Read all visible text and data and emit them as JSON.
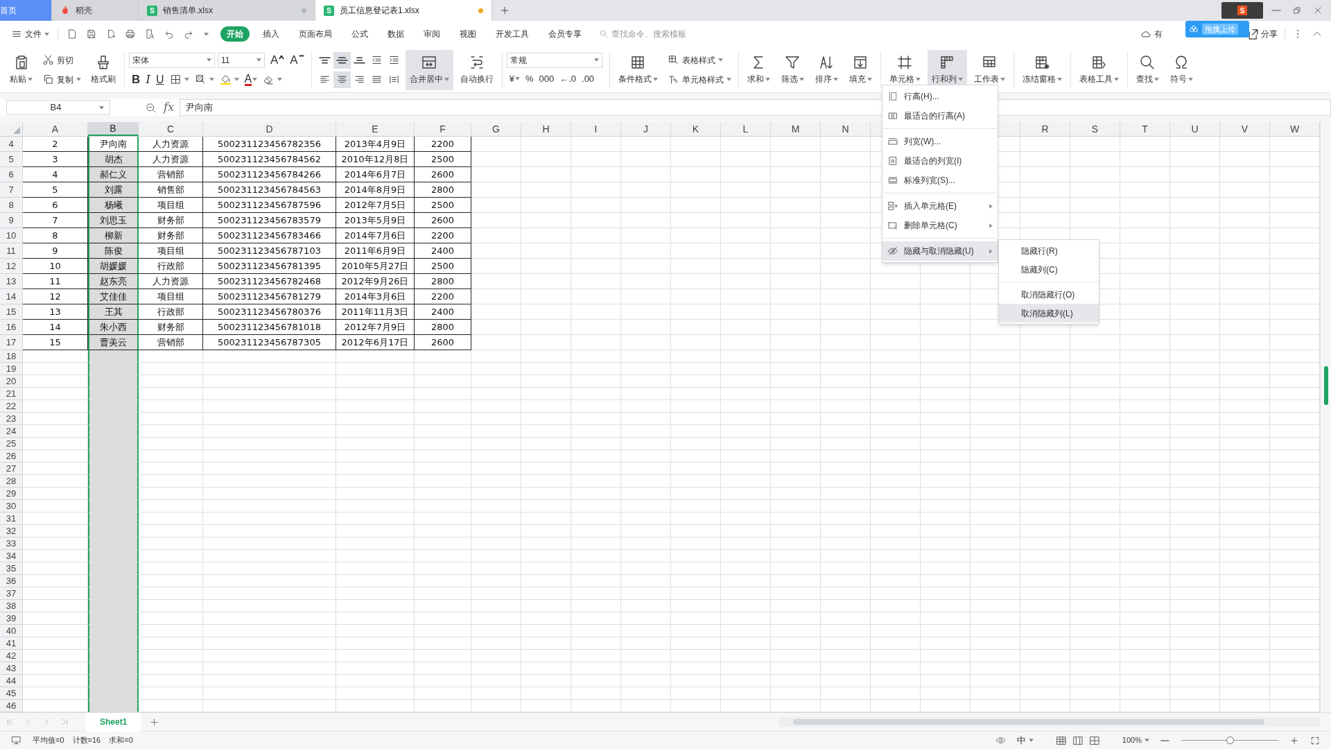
{
  "doc_tabs": [
    {
      "label": "首页",
      "kind": "home",
      "selected": false
    },
    {
      "label": "稻壳",
      "kind": "docer",
      "selected": false
    },
    {
      "label": "销售清单.xlsx",
      "kind": "sheet",
      "badge": "S",
      "modified": false,
      "selected": false
    },
    {
      "label": "员工信息登记表1.xlsx",
      "kind": "sheet",
      "badge": "S",
      "modified": true,
      "selected": true
    }
  ],
  "overlay": {
    "ime_badge": "S",
    "upload_label": "拖拽上传"
  },
  "menu_bar": {
    "file_label": "文件",
    "tabs": [
      {
        "label": "开始",
        "selected": true
      },
      {
        "label": "插入",
        "selected": false
      },
      {
        "label": "页面布局",
        "selected": false
      },
      {
        "label": "公式",
        "selected": false
      },
      {
        "label": "数据",
        "selected": false
      },
      {
        "label": "审阅",
        "selected": false
      },
      {
        "label": "视图",
        "selected": false
      },
      {
        "label": "开发工具",
        "selected": false
      },
      {
        "label": "会员专享",
        "selected": false
      }
    ],
    "search": {
      "placeholder": "查找命令、搜索模板"
    },
    "cloud_label": "有",
    "share_label": "分享"
  },
  "ribbon": [
    [
      {
        "kind": "large",
        "label": "粘贴",
        "caret": true,
        "selected": false
      },
      {
        "kind": "stack",
        "top": [
          {
            "label": "剪切",
            "caret": false
          }
        ],
        "bottom": [
          {
            "label": "复制",
            "caret": true
          }
        ]
      },
      {
        "kind": "large",
        "label": "格式刷",
        "caret": false,
        "selected": false
      }
    ],
    [
      {
        "kind": "stack",
        "top": [
          {
            "kind": "font-select",
            "value": "宋体"
          },
          {
            "kind": "size-select",
            "value": "11"
          },
          {
            "glyph": "A",
            "caret": false
          },
          {
            "glyph": "A",
            "caret": false
          }
        ],
        "bottom": [
          {
            "glyph": "B",
            "caret": false
          },
          {
            "glyph": "I",
            "caret": false
          },
          {
            "glyph": "U",
            "caret": false
          },
          {
            "caret": true
          },
          {
            "caret": true
          },
          {
            "caret": true
          },
          {
            "glyph": "A",
            "caret": true
          },
          {
            "caret": true
          }
        ]
      }
    ],
    [
      {
        "kind": "stack",
        "top": [
          {
            "selected": false
          },
          {
            "selected": true
          },
          {
            "selected": false
          },
          {
            "selected": false
          },
          {
            "selected": false
          }
        ],
        "bottom": [
          {
            "selected": false
          },
          {
            "selected": true
          },
          {
            "selected": false
          },
          {
            "selected": false
          },
          {
            "selected": false
          }
        ]
      },
      {
        "kind": "large",
        "label": "合并居中",
        "caret": true,
        "selected": true
      },
      {
        "kind": "large",
        "label": "自动换行",
        "caret": false,
        "selected": false
      }
    ],
    [
      {
        "kind": "stack",
        "top": [
          {
            "kind": "format-select",
            "value": "常规"
          }
        ],
        "bottom": [
          {
            "glyph": "¥",
            "caret": true
          },
          {
            "glyph": "%",
            "caret": false
          },
          {
            "glyph": "000",
            "caret": false
          },
          {
            "glyph": "←.0",
            "caret": false
          },
          {
            "glyph": ".00",
            "caret": false
          }
        ]
      }
    ],
    [
      {
        "kind": "large",
        "label": "条件格式",
        "caret": true,
        "selected": false
      },
      {
        "kind": "stack",
        "top": [
          {
            "label": "表格样式",
            "caret": true
          }
        ],
        "bottom": [
          {
            "label": "单元格样式",
            "caret": true
          }
        ]
      }
    ],
    [
      {
        "kind": "large",
        "label": "求和",
        "caret": true,
        "selected": false
      },
      {
        "kind": "large",
        "label": "筛选",
        "caret": true,
        "selected": false
      },
      {
        "kind": "large",
        "label": "排序",
        "caret": true,
        "selected": false
      },
      {
        "kind": "large",
        "label": "填充",
        "caret": true,
        "selected": false
      }
    ],
    [
      {
        "kind": "large",
        "label": "单元格",
        "caret": true,
        "selected": false
      },
      {
        "kind": "large",
        "label": "行和列",
        "caret": true,
        "selected": true
      },
      {
        "kind": "large",
        "label": "工作表",
        "caret": true,
        "selected": false
      }
    ],
    [
      {
        "kind": "large",
        "label": "冻结窗格",
        "caret": true,
        "selected": false
      }
    ],
    [
      {
        "kind": "large",
        "label": "表格工具",
        "caret": true,
        "selected": false
      }
    ],
    [
      {
        "kind": "large",
        "label": "查找",
        "caret": true,
        "selected": false
      },
      {
        "kind": "large",
        "label": "符号",
        "caret": true,
        "selected": false
      }
    ]
  ],
  "formula_bar": {
    "name_box": "B4",
    "fx_label": "fx",
    "value": "尹向南"
  },
  "columns": [
    {
      "label": "A",
      "selected": false
    },
    {
      "label": "B",
      "selected": true
    },
    {
      "label": "C",
      "selected": false
    },
    {
      "label": "D",
      "selected": false
    },
    {
      "label": "E",
      "selected": false
    },
    {
      "label": "F",
      "selected": false
    },
    {
      "label": "G",
      "selected": false
    },
    {
      "label": "H",
      "selected": false
    },
    {
      "label": "I",
      "selected": false
    },
    {
      "label": "J",
      "selected": false
    },
    {
      "label": "K",
      "selected": false
    },
    {
      "label": "L",
      "selected": false
    },
    {
      "label": "M",
      "selected": false
    },
    {
      "label": "N",
      "selected": false
    },
    {
      "label": "R",
      "selected": false
    },
    {
      "label": "S",
      "selected": false
    },
    {
      "label": "T",
      "selected": false
    },
    {
      "label": "U",
      "selected": false
    },
    {
      "label": "V",
      "selected": false
    },
    {
      "label": "W",
      "selected": false
    }
  ],
  "rows": [
    {
      "number": "4",
      "active": true,
      "cells": [
        "2",
        "尹向南",
        "人力资源",
        "500231123456782356",
        "2013年4月9日",
        "2200"
      ]
    },
    {
      "number": "5",
      "active": false,
      "cells": [
        "3",
        "胡杰",
        "人力资源",
        "500231123456784562",
        "2010年12月8日",
        "2500"
      ]
    },
    {
      "number": "6",
      "active": false,
      "cells": [
        "4",
        "郝仁义",
        "营销部",
        "500231123456784266",
        "2014年6月7日",
        "2600"
      ]
    },
    {
      "number": "7",
      "active": false,
      "cells": [
        "5",
        "刘露",
        "销售部",
        "500231123456784563",
        "2014年8月9日",
        "2800"
      ]
    },
    {
      "number": "8",
      "active": false,
      "cells": [
        "6",
        "杨曦",
        "项目组",
        "500231123456787596",
        "2012年7月5日",
        "2500"
      ]
    },
    {
      "number": "9",
      "active": false,
      "cells": [
        "7",
        "刘思玉",
        "财务部",
        "500231123456783579",
        "2013年5月9日",
        "2600"
      ]
    },
    {
      "number": "10",
      "active": false,
      "cells": [
        "8",
        "柳新",
        "财务部",
        "500231123456783466",
        "2014年7月6日",
        "2200"
      ]
    },
    {
      "number": "11",
      "active": false,
      "cells": [
        "9",
        "陈俊",
        "项目组",
        "500231123456787103",
        "2011年6月9日",
        "2400"
      ]
    },
    {
      "number": "12",
      "active": false,
      "cells": [
        "10",
        "胡媛媛",
        "行政部",
        "500231123456781395",
        "2010年5月27日",
        "2500"
      ]
    },
    {
      "number": "13",
      "active": false,
      "cells": [
        "11",
        "赵东亮",
        "人力资源",
        "500231123456782468",
        "2012年9月26日",
        "2800"
      ]
    },
    {
      "number": "14",
      "active": false,
      "cells": [
        "12",
        "艾佳佳",
        "项目组",
        "500231123456781279",
        "2014年3月6日",
        "2200"
      ]
    },
    {
      "number": "15",
      "active": false,
      "cells": [
        "13",
        "王其",
        "行政部",
        "500231123456780376",
        "2011年11月3日",
        "2400"
      ]
    },
    {
      "number": "16",
      "active": false,
      "cells": [
        "14",
        "朱小西",
        "财务部",
        "500231123456781018",
        "2012年7月9日",
        "2800"
      ]
    },
    {
      "number": "17",
      "active": false,
      "cells": [
        "15",
        "曹美云",
        "营销部",
        "500231123456787305",
        "2012年6月17日",
        "2600"
      ]
    },
    {
      "number": "18"
    },
    {
      "number": "19"
    },
    {
      "number": "20"
    },
    {
      "number": "21"
    },
    {
      "number": "22"
    },
    {
      "number": "23"
    },
    {
      "number": "24"
    },
    {
      "number": "25"
    },
    {
      "number": "26"
    },
    {
      "number": "27"
    },
    {
      "number": "28"
    },
    {
      "number": "29"
    },
    {
      "number": "30"
    },
    {
      "number": "31"
    },
    {
      "number": "32"
    },
    {
      "number": "33"
    },
    {
      "number": "34"
    },
    {
      "number": "35"
    },
    {
      "number": "36"
    },
    {
      "number": "37"
    },
    {
      "number": "38"
    },
    {
      "number": "39"
    },
    {
      "number": "40"
    },
    {
      "number": "41"
    },
    {
      "number": "42"
    },
    {
      "number": "43"
    },
    {
      "number": "44"
    },
    {
      "number": "45"
    },
    {
      "number": "46"
    }
  ],
  "context_menu": {
    "groups": [
      [
        {
          "label": "行高(H)...",
          "submenu": false,
          "highlighted": false
        },
        {
          "label": "最适合的行高(A)",
          "submenu": false,
          "highlighted": false
        }
      ],
      [
        {
          "label": "列宽(W)...",
          "submenu": false,
          "highlighted": false
        },
        {
          "label": "最适合的列宽(I)",
          "submenu": false,
          "highlighted": false
        },
        {
          "label": "标准列宽(S)...",
          "submenu": false,
          "highlighted": false
        }
      ],
      [
        {
          "label": "插入单元格(E)",
          "submenu": true,
          "highlighted": false
        },
        {
          "label": "删除单元格(C)",
          "submenu": true,
          "highlighted": false
        }
      ],
      [
        {
          "label": "隐藏与取消隐藏(U)",
          "submenu": true,
          "highlighted": true
        }
      ]
    ],
    "submenu": [
      [
        {
          "label": "隐藏行(R)",
          "highlighted": false
        },
        {
          "label": "隐藏列(C)",
          "highlighted": false
        }
      ],
      [
        {
          "label": "取消隐藏行(O)",
          "highlighted": false
        },
        {
          "label": "取消隐藏列(L)",
          "highlighted": true
        }
      ]
    ]
  },
  "sheet_tabs": [
    {
      "label": "Sheet1",
      "selected": true
    }
  ],
  "status_bar": {
    "stats": [
      "平均值=0",
      "计数=16",
      "求和=0"
    ],
    "input_mode": "中",
    "zoom": "100%",
    "zoom_slider": {
      "level": 0.5
    }
  }
}
